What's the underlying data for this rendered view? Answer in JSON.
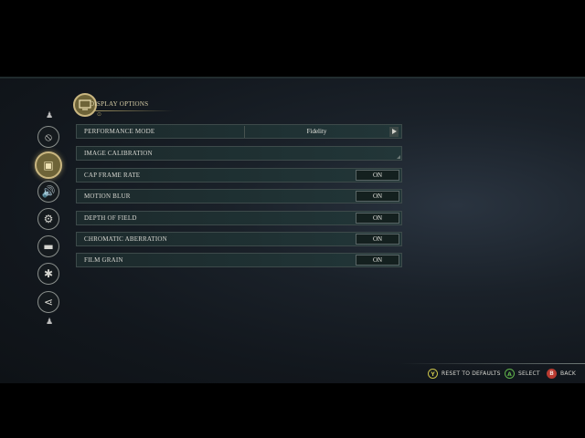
{
  "header": {
    "title": "DISPLAY OPTIONS",
    "subtitle_glyph": "⊙"
  },
  "side_nav": {
    "up_hint": "♟",
    "down_hint": "♟",
    "items": [
      {
        "icon": "compass-icon",
        "glyph": "⦸",
        "active": false
      },
      {
        "icon": "display-icon",
        "glyph": "▣",
        "active": true
      },
      {
        "icon": "audio-icon",
        "glyph": "🔊",
        "active": false
      },
      {
        "icon": "gear-icon",
        "glyph": "⚙",
        "active": false
      },
      {
        "icon": "controller-icon",
        "glyph": "▬",
        "active": false
      },
      {
        "icon": "accessibility-icon",
        "glyph": "✱",
        "active": false
      },
      {
        "icon": "share-icon",
        "glyph": "⋖",
        "active": false
      }
    ]
  },
  "options": {
    "performance_mode": {
      "label": "PERFORMANCE MODE",
      "value": "Fidelity"
    },
    "image_calibration": {
      "label": "IMAGE CALIBRATION"
    },
    "cap_frame_rate": {
      "label": "CAP FRAME RATE",
      "value": "ON"
    },
    "motion_blur": {
      "label": "MOTION BLUR",
      "value": "ON"
    },
    "depth_of_field": {
      "label": "DEPTH OF FIELD",
      "value": "ON"
    },
    "chromatic_aberration": {
      "label": "CHROMATIC ABERRATION",
      "value": "ON"
    },
    "film_grain": {
      "label": "FILM GRAIN",
      "value": "ON"
    }
  },
  "footer": {
    "reset": {
      "button": "Y",
      "label": "RESET TO DEFAULTS",
      "color": "#c9c24a"
    },
    "select": {
      "button": "A",
      "label": "SELECT",
      "color": "#5fb14a"
    },
    "back": {
      "button": "B",
      "label": "BACK",
      "color": "#d0463a"
    }
  },
  "colors": {
    "accent_gold": "#c9b680",
    "row_bg": "#1f3133",
    "text": "#d8d8d2"
  }
}
